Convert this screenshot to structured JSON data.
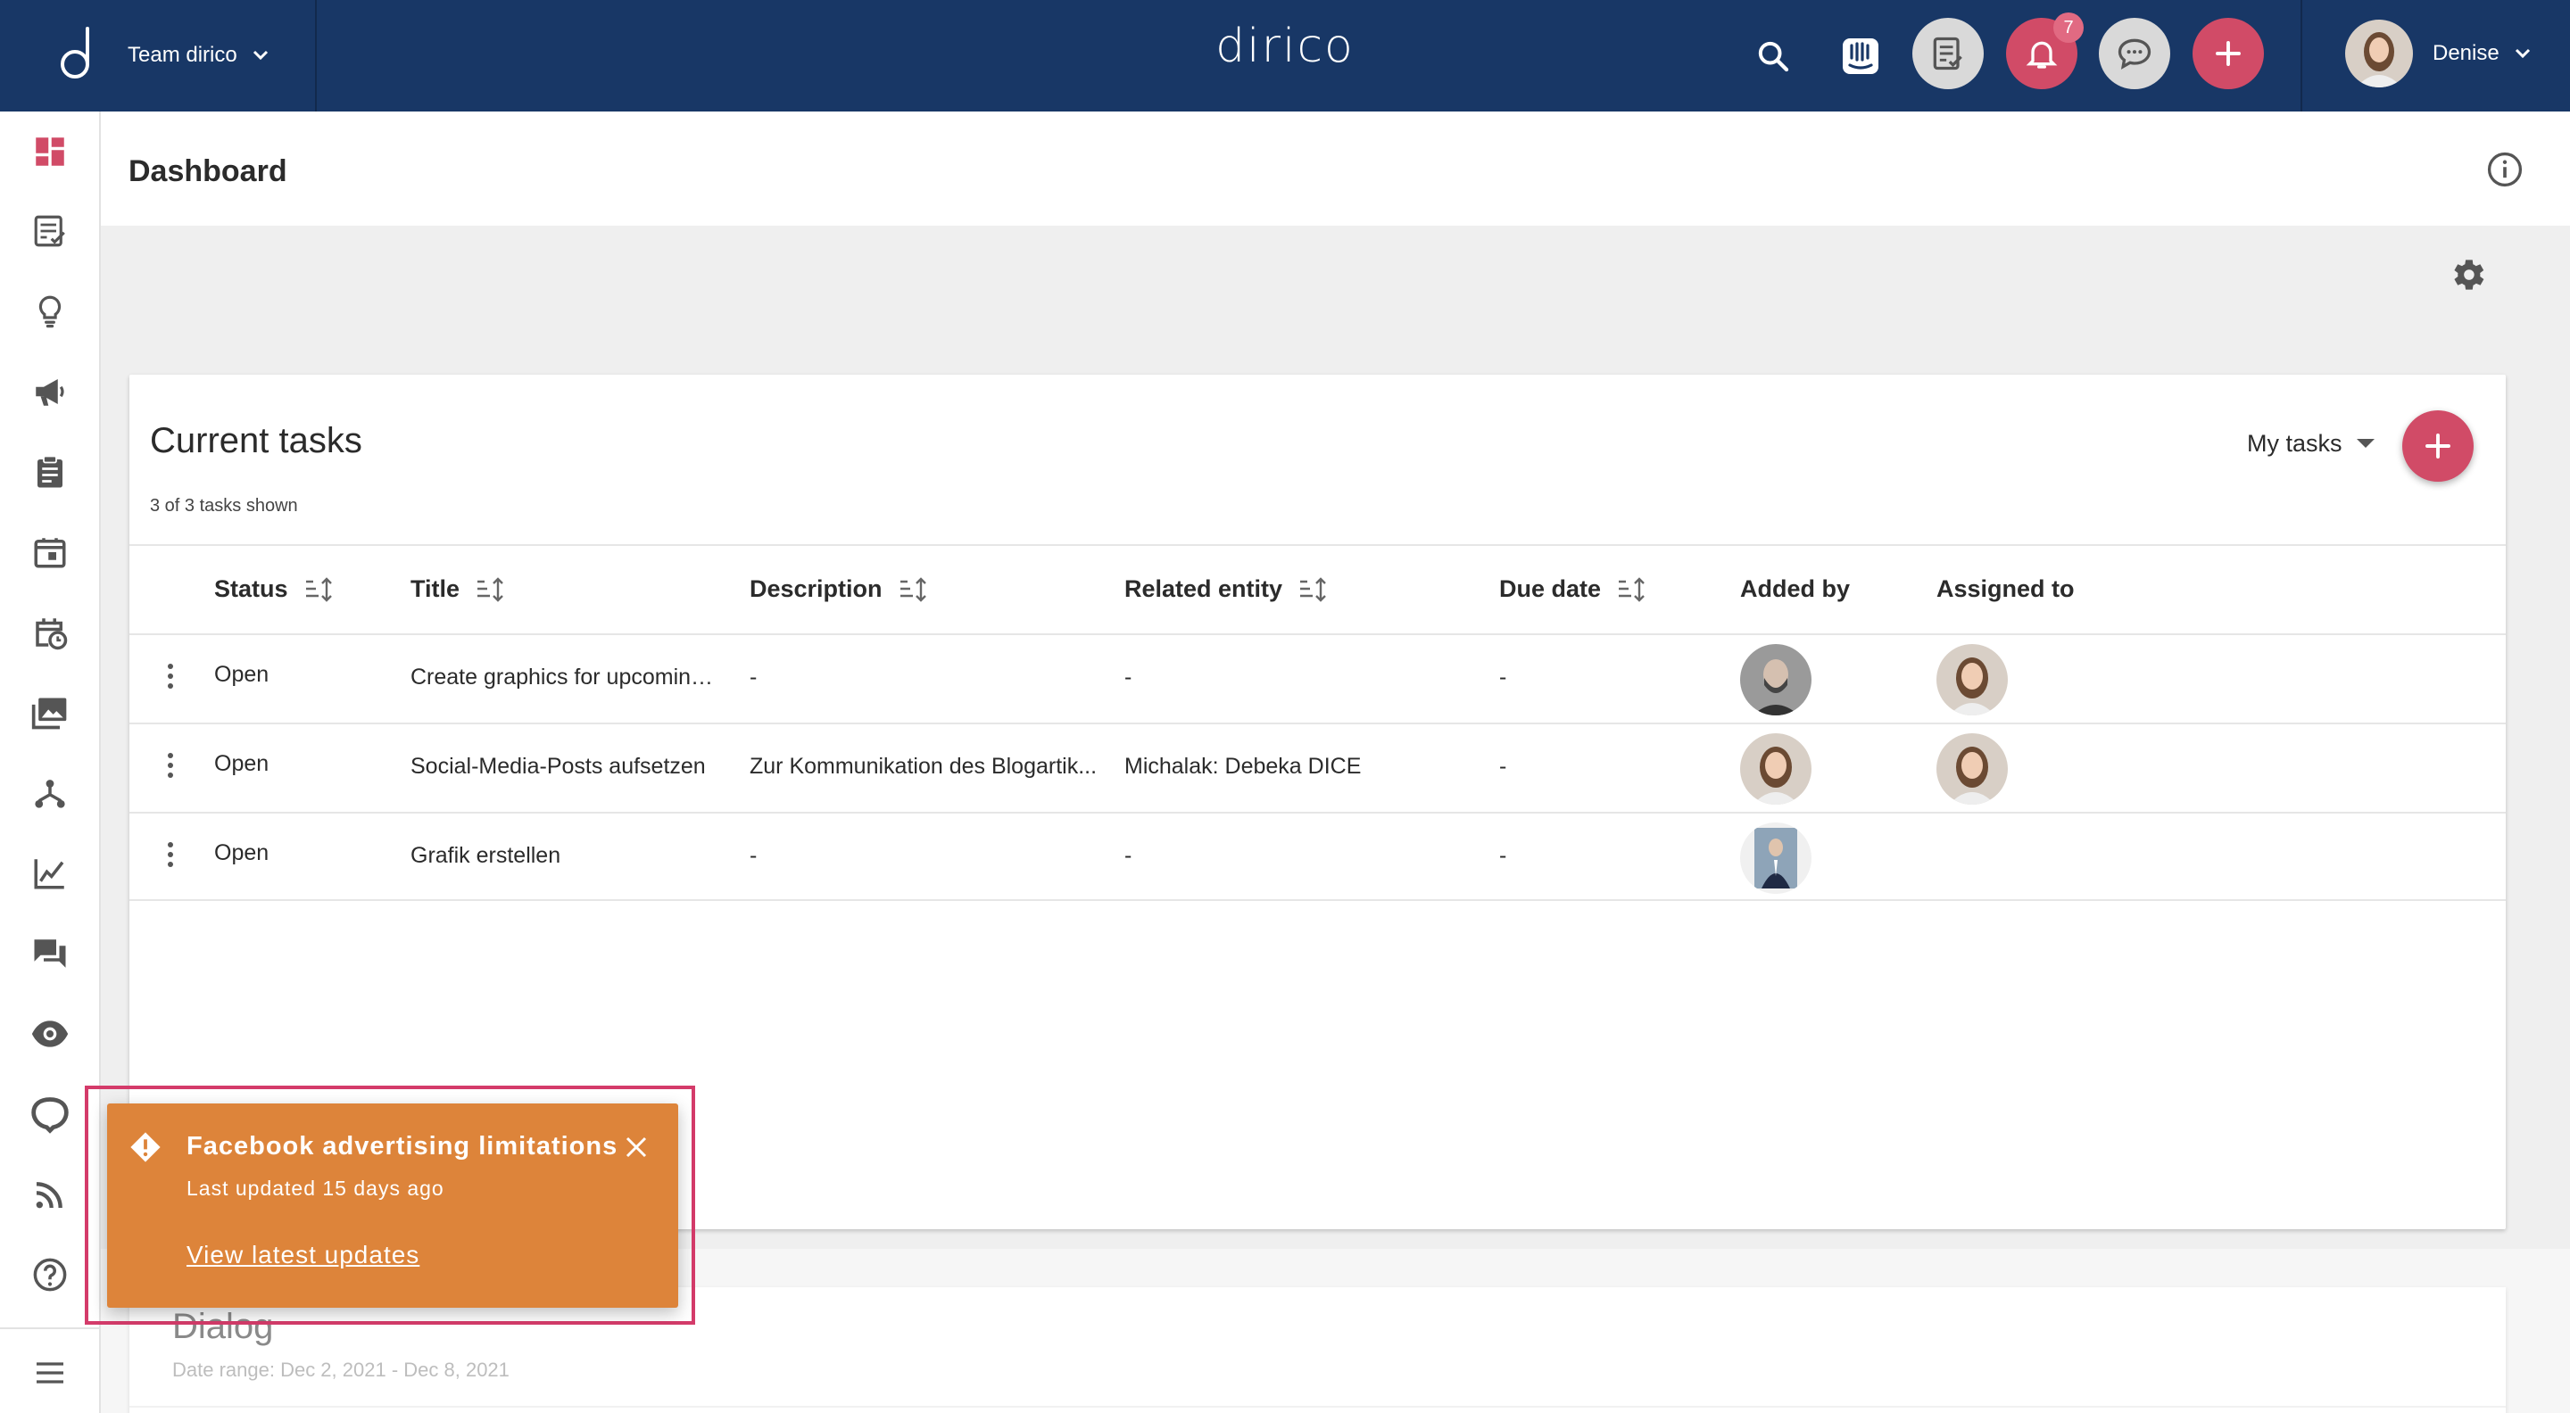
{
  "topbar": {
    "team_label": "Team dirico",
    "brand": "dirico",
    "notifications_count": "7",
    "user_name": "Denise"
  },
  "page": {
    "title": "Dashboard"
  },
  "tasks_card": {
    "title": "Current tasks",
    "subtitle": "3 of 3 tasks shown",
    "filter_label": "My tasks",
    "columns": [
      "Status",
      "Title",
      "Description",
      "Related entity",
      "Due date",
      "Added by",
      "Assigned to"
    ],
    "rows": [
      {
        "status": "Open",
        "title": "Create graphics for upcoming ...",
        "description": "-",
        "related": "-",
        "due": "-",
        "added_by": "man-bald-beard",
        "assigned_to": "woman-denise"
      },
      {
        "status": "Open",
        "title": "Social-Media-Posts aufsetzen",
        "description": "Zur Kommunikation des Blogartik...",
        "related": "Michalak: Debeka DICE",
        "due": "-",
        "added_by": "woman-denise",
        "assigned_to": "woman-denise"
      },
      {
        "status": "Open",
        "title": "Grafik erstellen",
        "description": "-",
        "related": "-",
        "due": "-",
        "added_by": "man-suit",
        "assigned_to": ""
      }
    ]
  },
  "dialog_card": {
    "title": "Dialog",
    "date_range": "Date range: Dec 2, 2021 - Dec 8, 2021"
  },
  "toast": {
    "title": "Facebook advertising limitations",
    "subtitle": "Last updated 15 days ago",
    "link": "View latest updates",
    "color": "#dd843a"
  },
  "colors": {
    "topbar": "#183766",
    "accent": "#d14b67",
    "sidebar_active": "#d14b67"
  },
  "sidebar_icons": [
    "dashboard-icon",
    "checklist-icon",
    "lightbulb-icon",
    "megaphone-icon",
    "clipboard-icon",
    "calendar-icon",
    "calendar-clock-icon",
    "media-library-icon",
    "hierarchy-icon",
    "analytics-icon",
    "chat-icon",
    "eye-icon",
    "network-icon",
    "rss-icon",
    "help-icon",
    "menu-icon"
  ]
}
